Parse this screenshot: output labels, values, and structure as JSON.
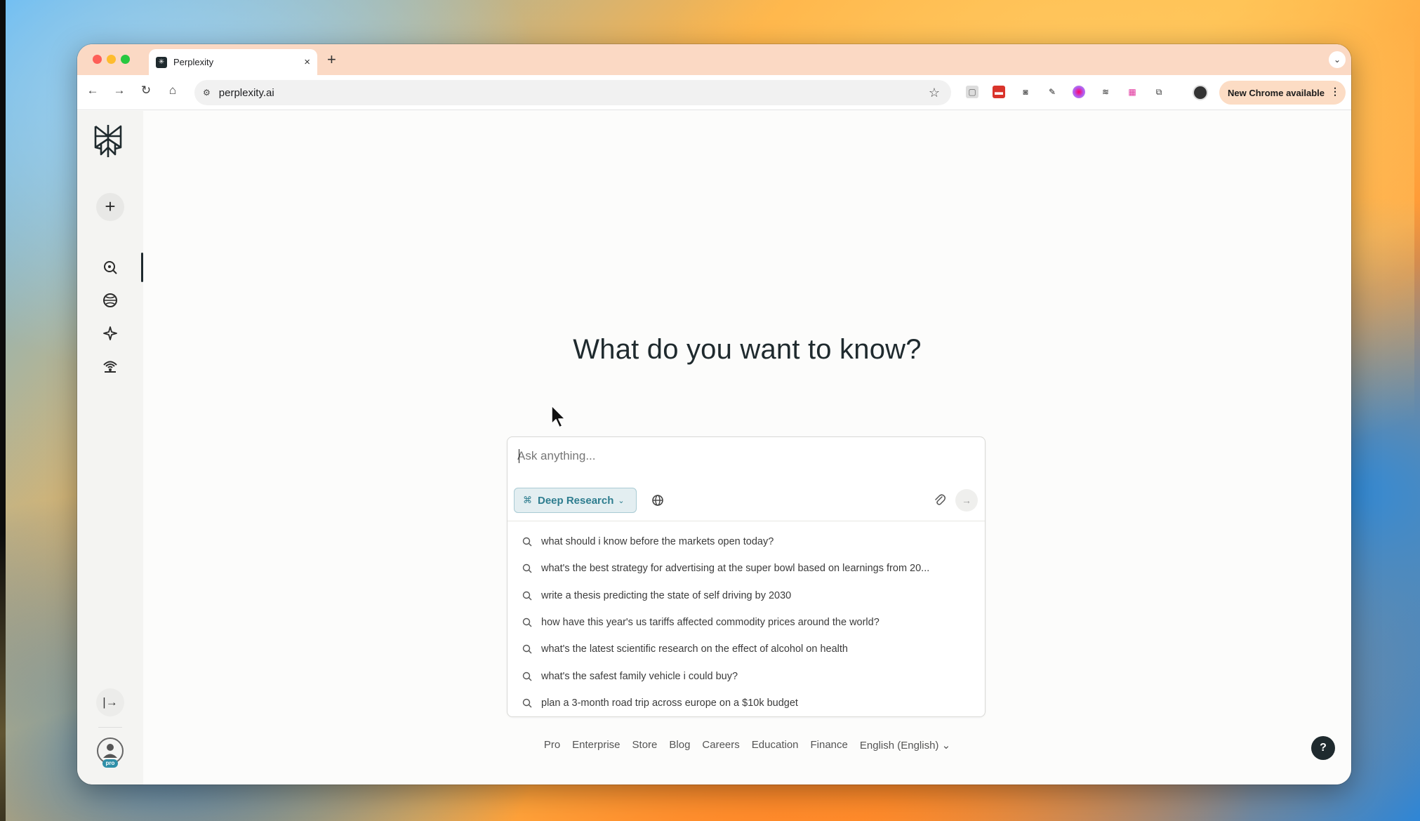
{
  "browser": {
    "tab_title": "Perplexity",
    "tab_close": "×",
    "new_tab": "+",
    "tab_menu": "⌄",
    "url": "perplexity.ai",
    "update_button": "New Chrome available",
    "update_menu": "⋮",
    "nav": {
      "back": "←",
      "forward": "→",
      "reload": "↻",
      "home": "⌂"
    }
  },
  "sidebar": {
    "new_thread": "+",
    "items": [
      {
        "name": "home",
        "icon": "search-icon"
      },
      {
        "name": "discover",
        "icon": "globe-icon"
      },
      {
        "name": "spaces",
        "icon": "sparkle-icon"
      },
      {
        "name": "library",
        "icon": "broadcast-icon"
      }
    ],
    "collapse": "|→",
    "pro_badge": "pro"
  },
  "main": {
    "heading": "What do you want to know?",
    "search": {
      "placeholder": "Ask anything...",
      "mode_label": "Deep Research",
      "mode_icon": "⌘",
      "mode_chevron": "⌄",
      "submit": "→",
      "attach": "📎"
    },
    "suggestions": [
      "what should i know before the markets open today?",
      "what's the best strategy for advertising at the super bowl based on learnings from 20...",
      "write a thesis predicting the state of self driving by 2030",
      "how have this year's us tariffs affected commodity prices around the world?",
      "what's the latest scientific research on the effect of alcohol on health",
      "what's the safest family vehicle i could buy?",
      "plan a 3-month road trip across europe on a $10k budget"
    ],
    "footer_links": [
      "Pro",
      "Enterprise",
      "Store",
      "Blog",
      "Careers",
      "Education",
      "Finance",
      "English (English) ⌄"
    ],
    "help": "?"
  },
  "colors": {
    "accent": "#2e7d8f",
    "tabbar": "#fbd9c4",
    "text_dark": "#1f2a2e"
  }
}
